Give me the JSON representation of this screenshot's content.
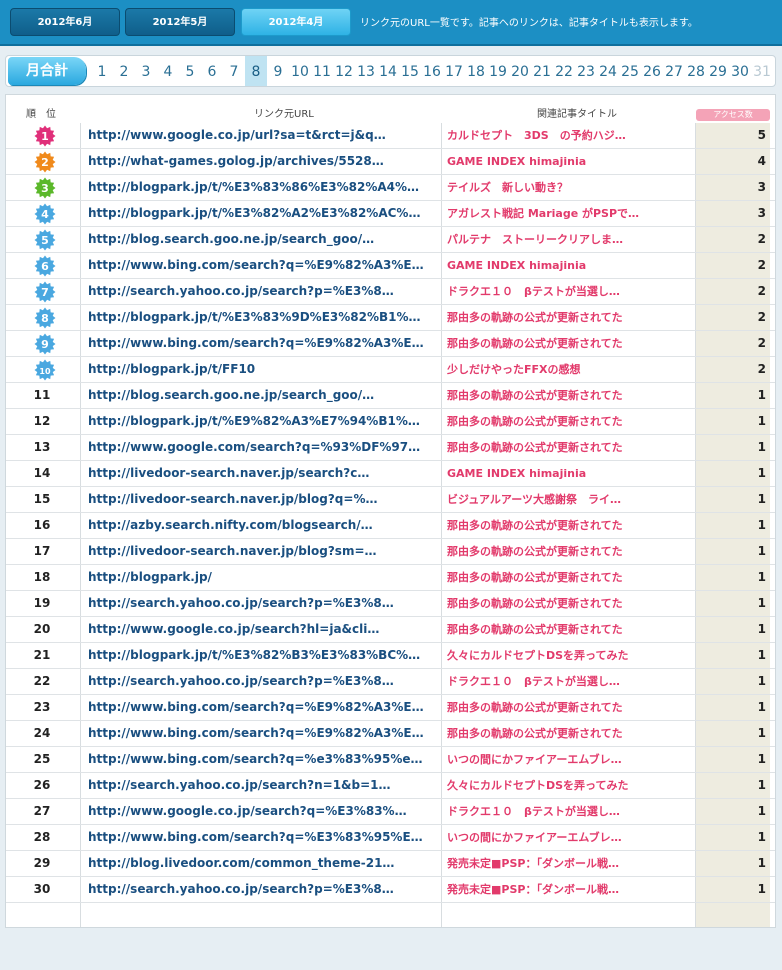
{
  "header": {
    "month_tabs": [
      {
        "label": "2012年6月",
        "active": false
      },
      {
        "label": "2012年5月",
        "active": false
      },
      {
        "label": "2012年4月",
        "active": true
      }
    ],
    "note": "リンク元のURL一覧です。記事へのリンクは、記事タイトルも表示します。"
  },
  "day_nav": {
    "month_total_label": "月合計",
    "days": [
      "1",
      "2",
      "3",
      "4",
      "5",
      "6",
      "7",
      "8",
      "9",
      "10",
      "11",
      "12",
      "13",
      "14",
      "15",
      "16",
      "17",
      "18",
      "19",
      "20",
      "21",
      "22",
      "23",
      "24",
      "25",
      "26",
      "27",
      "28",
      "29",
      "30",
      "31"
    ],
    "active_day": "8",
    "disabled_day": "31"
  },
  "table": {
    "headers": {
      "rank": "順　位",
      "url": "リンク元URL",
      "title": "関連記事タイトル",
      "access": "アクセス数"
    },
    "badge_colors": [
      "#e0307a",
      "#f08a1c",
      "#5bb82a",
      "#4aa8e0",
      "#4aa8e0",
      "#4aa8e0",
      "#4aa8e0",
      "#4aa8e0",
      "#4aa8e0",
      "#4aa8e0"
    ],
    "rows": [
      {
        "rank": "1",
        "url": "http://www.google.co.jp/url?sa=t&rct=j&q…",
        "title": "カルドセプト　3DS　の予約ハジ…",
        "count": "5"
      },
      {
        "rank": "2",
        "url": "http://what-games.golog.jp/archives/5528…",
        "title": "GAME INDEX himajinia",
        "count": "4"
      },
      {
        "rank": "3",
        "url": "http://blogpark.jp/t/%E3%83%86%E3%82%A4%…",
        "title": "テイルズ　新しい動き？",
        "count": "3"
      },
      {
        "rank": "4",
        "url": "http://blogpark.jp/t/%E3%82%A2%E3%82%AC%…",
        "title": "アガレスト戦記 Mariage がPSPで…",
        "count": "3"
      },
      {
        "rank": "5",
        "url": "http://blog.search.goo.ne.jp/search_goo/…",
        "title": "パルテナ　ストーリークリアしま…",
        "count": "2"
      },
      {
        "rank": "6",
        "url": "http://www.bing.com/search?q=%E9%82%A3%E…",
        "title": "GAME INDEX himajinia",
        "count": "2"
      },
      {
        "rank": "7",
        "url": "http://search.yahoo.co.jp/search?p=%E3%8…",
        "title": "ドラクエ１０　βテストが当選し…",
        "count": "2"
      },
      {
        "rank": "8",
        "url": "http://blogpark.jp/t/%E3%83%9D%E3%82%B1%…",
        "title": "那由多の軌跡の公式が更新されてた",
        "count": "2"
      },
      {
        "rank": "9",
        "url": "http://www.bing.com/search?q=%E9%82%A3%E…",
        "title": "那由多の軌跡の公式が更新されてた",
        "count": "2"
      },
      {
        "rank": "10",
        "url": "http://blogpark.jp/t/FF10",
        "title": "少しだけやったFFXの感想",
        "count": "2"
      },
      {
        "rank": "11",
        "url": "http://blog.search.goo.ne.jp/search_goo/…",
        "title": "那由多の軌跡の公式が更新されてた",
        "count": "1"
      },
      {
        "rank": "12",
        "url": "http://blogpark.jp/t/%E9%82%A3%E7%94%B1%…",
        "title": "那由多の軌跡の公式が更新されてた",
        "count": "1"
      },
      {
        "rank": "13",
        "url": "http://www.google.com/search?q=%93%DF%97…",
        "title": "那由多の軌跡の公式が更新されてた",
        "count": "1"
      },
      {
        "rank": "14",
        "url": "http://livedoor-search.naver.jp/search?c…",
        "title": "GAME INDEX himajinia",
        "count": "1"
      },
      {
        "rank": "15",
        "url": "http://livedoor-search.naver.jp/blog?q=%…",
        "title": "ビジュアルアーツ大感謝祭　ライ…",
        "count": "1"
      },
      {
        "rank": "16",
        "url": "http://azby.search.nifty.com/blogsearch/…",
        "title": "那由多の軌跡の公式が更新されてた",
        "count": "1"
      },
      {
        "rank": "17",
        "url": "http://livedoor-search.naver.jp/blog?sm=…",
        "title": "那由多の軌跡の公式が更新されてた",
        "count": "1"
      },
      {
        "rank": "18",
        "url": "http://blogpark.jp/",
        "title": "那由多の軌跡の公式が更新されてた",
        "count": "1"
      },
      {
        "rank": "19",
        "url": "http://search.yahoo.co.jp/search?p=%E3%8…",
        "title": "那由多の軌跡の公式が更新されてた",
        "count": "1"
      },
      {
        "rank": "20",
        "url": "http://www.google.co.jp/search?hl=ja&cli…",
        "title": "那由多の軌跡の公式が更新されてた",
        "count": "1"
      },
      {
        "rank": "21",
        "url": "http://blogpark.jp/t/%E3%82%B3%E3%83%BC%…",
        "title": "久々にカルドセプトDSを弄ってみた",
        "count": "1"
      },
      {
        "rank": "22",
        "url": "http://search.yahoo.co.jp/search?p=%E3%8…",
        "title": "ドラクエ１０　βテストが当選し…",
        "count": "1"
      },
      {
        "rank": "23",
        "url": "http://www.bing.com/search?q=%E9%82%A3%E…",
        "title": "那由多の軌跡の公式が更新されてた",
        "count": "1"
      },
      {
        "rank": "24",
        "url": "http://www.bing.com/search?q=%E9%82%A3%E…",
        "title": "那由多の軌跡の公式が更新されてた",
        "count": "1"
      },
      {
        "rank": "25",
        "url": "http://www.bing.com/search?q=%e3%83%95%e…",
        "title": "いつの間にかファイアーエムブレ…",
        "count": "1"
      },
      {
        "rank": "26",
        "url": "http://search.yahoo.co.jp/search?n=1&b=1…",
        "title": "久々にカルドセプトDSを弄ってみた",
        "count": "1"
      },
      {
        "rank": "27",
        "url": "http://www.google.co.jp/search?q=%E3%83%…",
        "title": "ドラクエ１０　βテストが当選し…",
        "count": "1"
      },
      {
        "rank": "28",
        "url": "http://www.bing.com/search?q=%E3%83%95%E…",
        "title": "いつの間にかファイアーエムブレ…",
        "count": "1"
      },
      {
        "rank": "29",
        "url": "http://blog.livedoor.com/common_theme-21…",
        "title": "発売未定■PSP：「ダンボール戦…",
        "count": "1"
      },
      {
        "rank": "30",
        "url": "http://search.yahoo.co.jp/search?p=%E3%8…",
        "title": "発売未定■PSP：「ダンボール戦…",
        "count": "1"
      }
    ]
  }
}
